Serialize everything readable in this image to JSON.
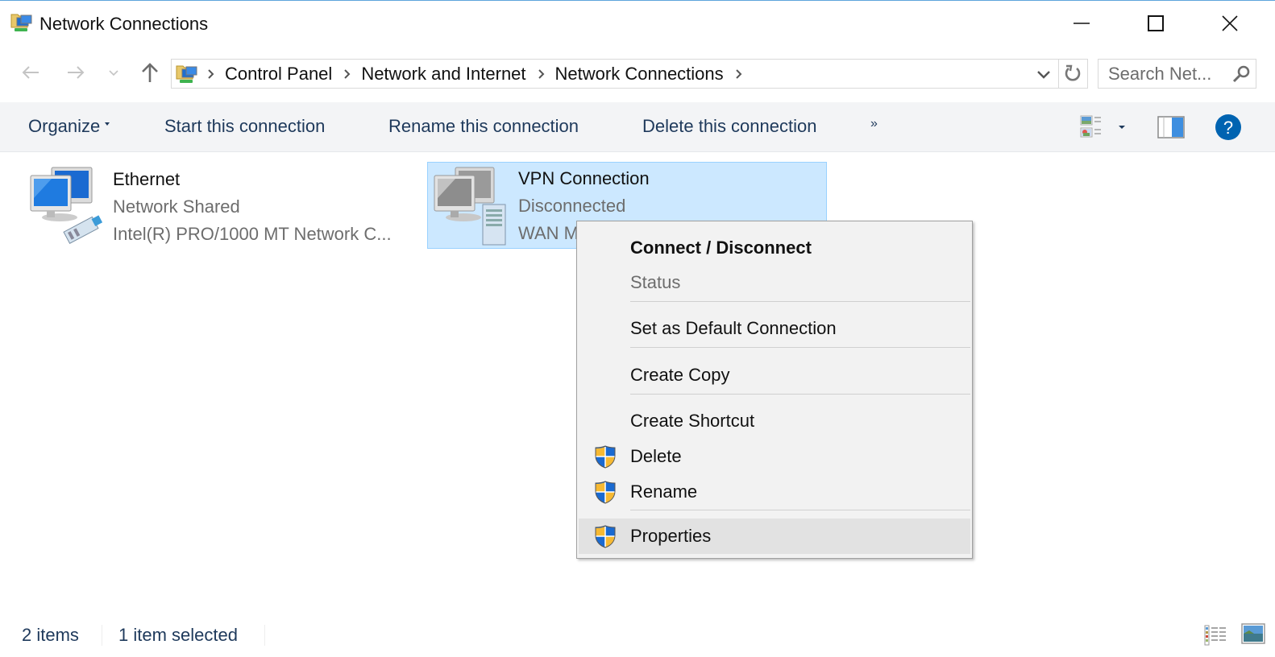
{
  "window": {
    "title": "Network Connections",
    "app_icon": "network-connections-icon",
    "controls": {
      "minimize": "minimize-icon",
      "maximize": "maximize-icon",
      "close": "close-icon"
    }
  },
  "navigation": {
    "back": "back-arrow-icon",
    "forward": "forward-arrow-icon",
    "recent": "chevron-down-icon",
    "up": "up-arrow-icon"
  },
  "address": {
    "breadcrumbs": [
      "Control Panel",
      "Network and Internet",
      "Network Connections"
    ],
    "dropdown": "chevron-down-icon",
    "refresh": "refresh-icon"
  },
  "search": {
    "placeholder": "Search Net..."
  },
  "commandbar": {
    "organize": "Organize",
    "start": "Start this connection",
    "rename": "Rename this connection",
    "delete": "Delete this connection",
    "more": "»"
  },
  "items": [
    {
      "name": "Ethernet",
      "line2": "Network  Shared",
      "line3": "Intel(R) PRO/1000 MT Network C...",
      "selected": false
    },
    {
      "name": "VPN Connection",
      "line2": "Disconnected",
      "line3": "WAN Miniport (IKEv2)",
      "line3_visible": "WAN M",
      "selected": true
    }
  ],
  "context_menu": {
    "items": [
      {
        "label": "Connect / Disconnect",
        "bold": true,
        "shield": false
      },
      {
        "label": "Status",
        "disabled": true,
        "shield": false
      },
      {
        "label": "Set as Default Connection",
        "shield": false
      },
      {
        "label": "Create Copy",
        "shield": false
      },
      {
        "label": "Create Shortcut",
        "shield": false
      },
      {
        "label": "Delete",
        "shield": true
      },
      {
        "label": "Rename",
        "shield": true
      },
      {
        "label": "Properties",
        "shield": true,
        "highlighted": true
      }
    ]
  },
  "statusbar": {
    "count": "2 items",
    "selection": "1 item selected"
  },
  "colors": {
    "accent_text": "#1e395b",
    "selection_bg": "#cce8ff",
    "selection_border": "#99d1ff",
    "help_blue": "#0063b1"
  }
}
